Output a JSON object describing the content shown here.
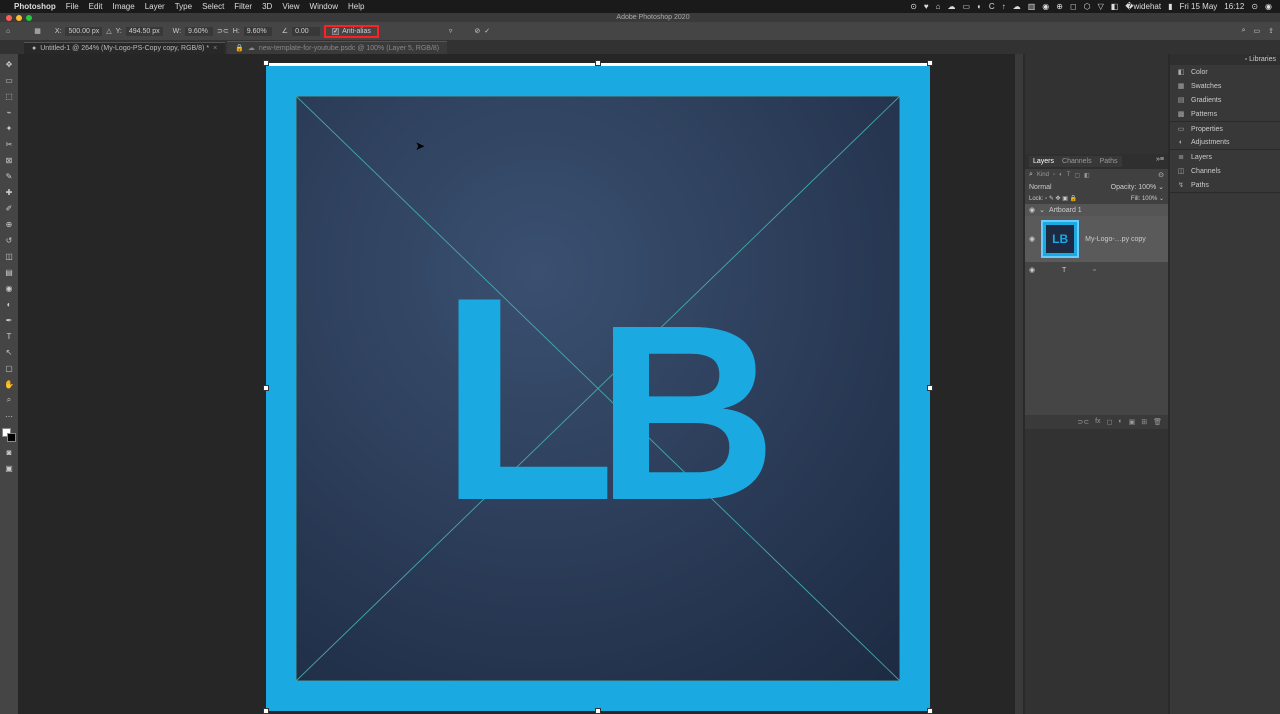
{
  "mac_menu": {
    "app": "Photoshop",
    "items": [
      "File",
      "Edit",
      "Image",
      "Layer",
      "Type",
      "Select",
      "Filter",
      "3D",
      "View",
      "Window",
      "Help"
    ],
    "date": "Fri 15 May",
    "time": "16:12"
  },
  "window": {
    "title": "Adobe Photoshop 2020"
  },
  "options_bar": {
    "x_label": "X:",
    "x_val": "500.00 px",
    "y_label": "Y:",
    "y_val": "494.50 px",
    "w_label": "W:",
    "w_val": "9.60%",
    "h_label": "H:",
    "h_val": "9.60%",
    "angle": "0.00",
    "anti_alias": "Anti-alias"
  },
  "tabs": [
    {
      "label": "Untitled-1 @ 264% (My-Logo-PS-Copy copy, RGB/8) *",
      "active": true,
      "pinned": true
    },
    {
      "label": "new-template-for-youtube.psdc @ 100% (Layer 5, RGB/8)",
      "active": false,
      "pinned": true
    }
  ],
  "right_panels": {
    "group1": [
      "Color",
      "Swatches",
      "Gradients",
      "Patterns"
    ],
    "group2": [
      "Properties",
      "Adjustments"
    ],
    "group3": [
      "Layers",
      "Channels",
      "Paths"
    ],
    "libraries": "Libraries"
  },
  "layers_panel": {
    "tabs": [
      "Layers",
      "Channels",
      "Paths"
    ],
    "filter_label": "Kind",
    "blend_mode": "Normal",
    "opacity_label": "Opacity:",
    "opacity_val": "100%",
    "lock_label": "Lock:",
    "fill_label": "Fill:",
    "fill_val": "100%",
    "artboard": "Artboard 1",
    "layer1": "My-Logo-…py copy",
    "layer_thumb_text": "LB",
    "text_layer_glyph": "T"
  },
  "canvas": {
    "logo_text": "LB"
  }
}
